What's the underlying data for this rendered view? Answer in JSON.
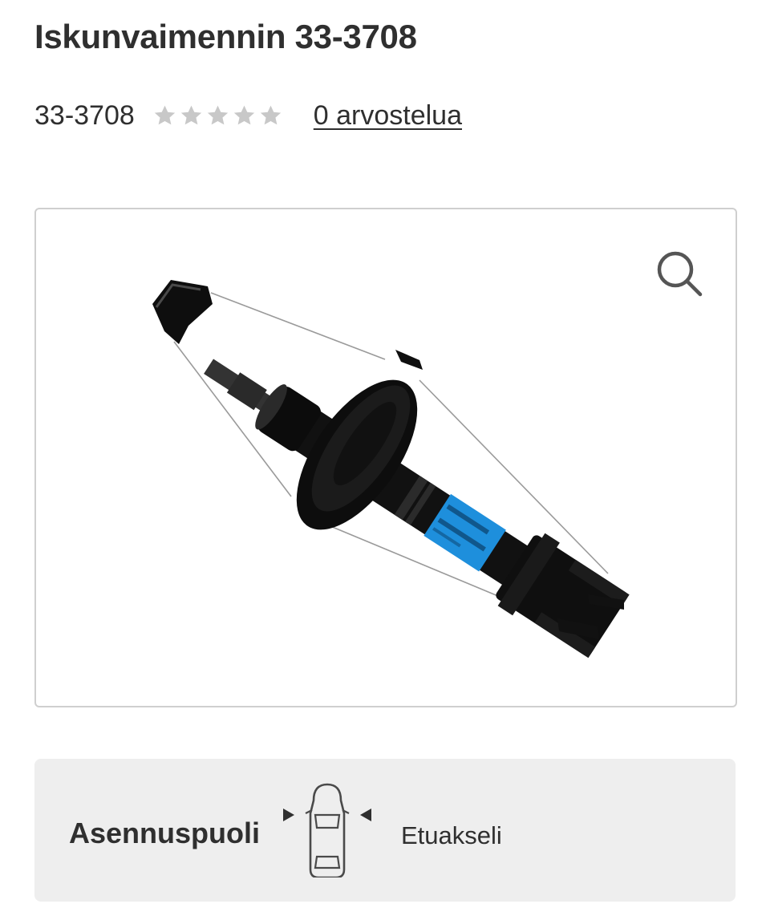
{
  "product": {
    "title": "Iskunvaimennin 33-3708",
    "sku": "33-3708",
    "rating": {
      "stars_filled": 0,
      "stars_total": 5
    },
    "reviews_link": "0 arvostelua"
  },
  "gallery": {
    "zoom_icon": "magnifier-icon"
  },
  "spec": {
    "label": "Asennuspuoli",
    "icon": "car-front-axle-icon",
    "value": "Etuakseli"
  },
  "colors": {
    "star_empty": "#c8c8c8",
    "spec_bg": "#eeeeee",
    "label_blue": "#1e8fdc"
  }
}
